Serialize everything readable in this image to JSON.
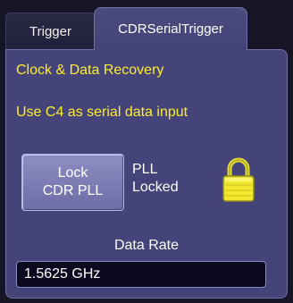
{
  "tabs": [
    {
      "label": "Trigger",
      "active": false
    },
    {
      "label": "CDRSerialTrigger",
      "active": true
    }
  ],
  "panel": {
    "heading": "Clock & Data Recovery",
    "subheading": "Use C4 as serial data input",
    "lock_button": {
      "line1": "Lock",
      "line2": "CDR PLL"
    },
    "pll_status": {
      "line1": "PLL",
      "line2": "Locked",
      "icon": "padlock-locked-icon"
    },
    "data_rate": {
      "label": "Data Rate",
      "value": "1.5625 GHz"
    }
  },
  "colors": {
    "accent_text": "#ffee2a",
    "panel_bg": "#44437a",
    "button_bg": "#8e8dc3",
    "padlock": "#f2e82e"
  }
}
